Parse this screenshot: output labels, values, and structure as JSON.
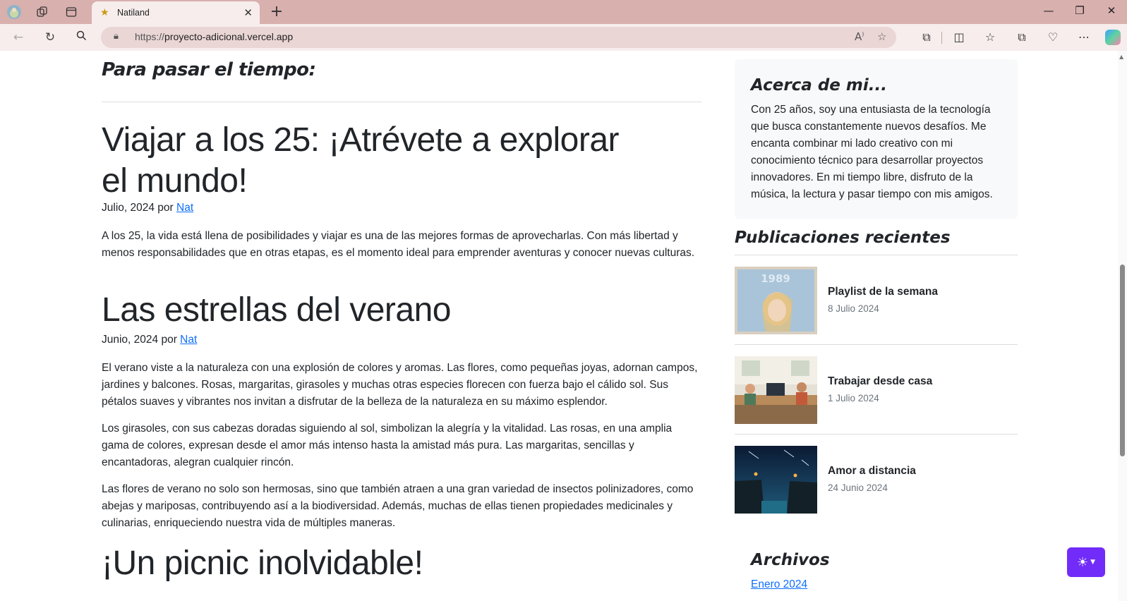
{
  "browser": {
    "tab_title": "Natiland",
    "url_protocol": "https://",
    "url_host": "proyecto-adicional.vercel.app"
  },
  "main": {
    "section_title": "Para pasar el tiempo:",
    "posts": [
      {
        "title": "Viajar a los 25: ¡Atrévete a explorar el mundo!",
        "date": "Julio, 2024 por ",
        "author": "Nat",
        "paragraphs": [
          "A los 25, la vida está llena de posibilidades y viajar es una de las mejores formas de aprovecharlas. Con más libertad y menos responsabilidades que en otras etapas, es el momento ideal para emprender aventuras y conocer nuevas culturas."
        ]
      },
      {
        "title": "Las estrellas del verano",
        "date": "Junio, 2024 por ",
        "author": "Nat",
        "paragraphs": [
          "El verano viste a la naturaleza con una explosión de colores y aromas. Las flores, como pequeñas joyas, adornan campos, jardines y balcones. Rosas, margaritas, girasoles y muchas otras especies florecen con fuerza bajo el cálido sol. Sus pétalos suaves y vibrantes nos invitan a disfrutar de la belleza de la naturaleza en su máximo esplendor.",
          "Los girasoles, con sus cabezas doradas siguiendo al sol, simbolizan la alegría y la vitalidad. Las rosas, en una amplia gama de colores, expresan desde el amor más intenso hasta la amistad más pura. Las margaritas, sencillas y encantadoras, alegran cualquier rincón.",
          "Las flores de verano no solo son hermosas, sino que también atraen a una gran variedad de insectos polinizadores, como abejas y mariposas, contribuyendo así a la biodiversidad. Además, muchas de ellas tienen propiedades medicinales y culinarias, enriqueciendo nuestra vida de múltiples maneras."
        ]
      },
      {
        "title": "¡Un picnic inolvidable!"
      }
    ]
  },
  "sidebar": {
    "about_title": "Acerca de mi...",
    "about_text": "Con 25 años, soy una entusiasta de la tecnología que busca constantemente nuevos desafíos. Me encanta combinar mi lado creativo con mi conocimiento técnico para desarrollar proyectos innovadores. En mi tiempo libre, disfruto de la música, la lectura y pasar tiempo con mis amigos.",
    "recent_title": "Publicaciones recientes",
    "recent": [
      {
        "title": "Playlist de la semana",
        "date": "8 Julio 2024",
        "thumb_text": "1989"
      },
      {
        "title": "Trabajar desde casa",
        "date": "1 Julio 2024"
      },
      {
        "title": "Amor a distancia",
        "date": "24 Junio 2024"
      }
    ],
    "archives_title": "Archivos",
    "archive_links": [
      "Enero 2024"
    ]
  },
  "theme_toggle_icon": "sun-icon",
  "colors": {
    "accent": "#712cf9",
    "link": "#0d6efd",
    "text": "#212529",
    "muted": "#6c757d",
    "browser_chrome": "#d8b0ae"
  }
}
